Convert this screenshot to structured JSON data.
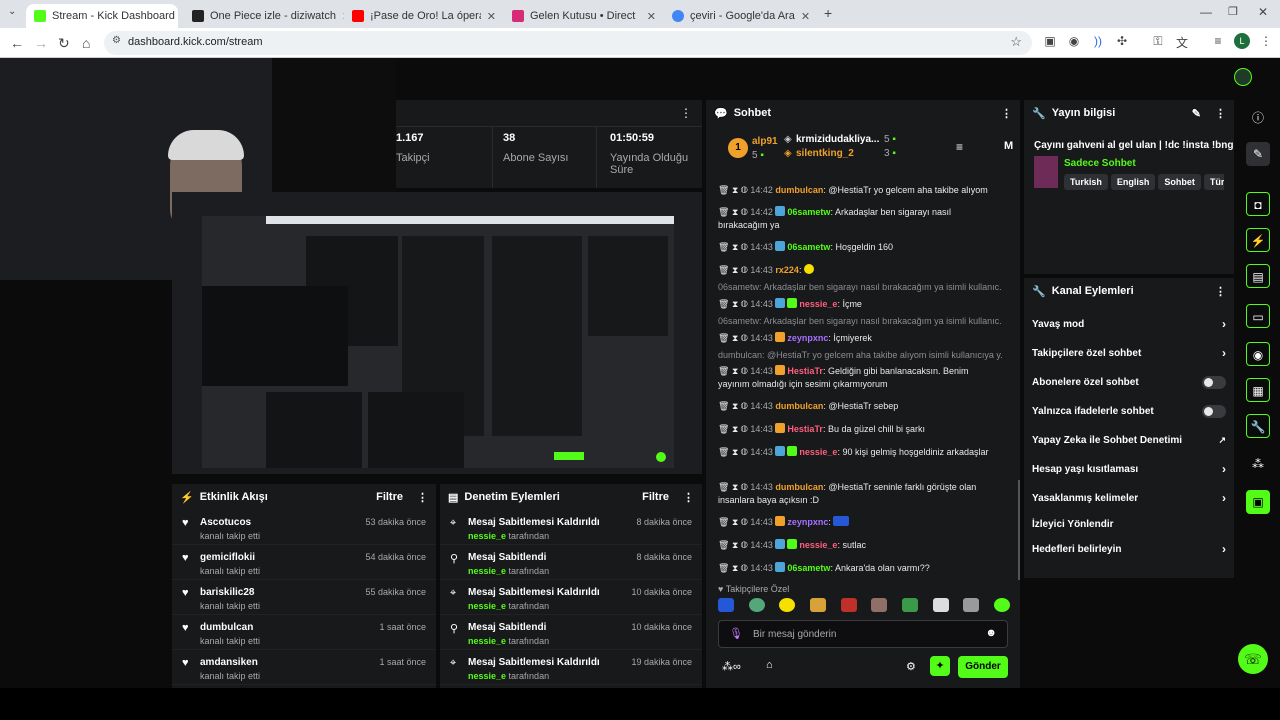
{
  "browser": {
    "tabs": [
      {
        "title": "Stream - Kick Dashboard",
        "color": "#53fc18"
      },
      {
        "title": "One Piece izle - diziwatch",
        "color": "#1d1d1d"
      },
      {
        "title": "¡Pase de Oro! La ópera y el roc",
        "color": "#ff0000"
      },
      {
        "title": "Gelen Kutusu • Direct",
        "color": "#d62976"
      },
      {
        "title": "çeviri - Google'da Ara",
        "color": "#4285f4"
      }
    ],
    "url": "dashboard.kick.com/stream",
    "profile_initial": "L"
  },
  "stats": [
    {
      "value": "1.167",
      "label": "Takipçi"
    },
    {
      "value": "38",
      "label": "Abone Sayısı"
    },
    {
      "value": "01:50:59",
      "label": "Yayında Olduğu Süre"
    }
  ],
  "activity": {
    "title": "Etkinlik Akışı",
    "filter": "Filtre",
    "items": [
      {
        "name": "Ascotucos",
        "sub": "kanalı takip etti",
        "time": "53 dakika önce"
      },
      {
        "name": "gemiciflokii",
        "sub": "kanalı takip etti",
        "time": "54 dakika önce"
      },
      {
        "name": "bariskilic28",
        "sub": "kanalı takip etti",
        "time": "55 dakika önce"
      },
      {
        "name": "dumbulcan",
        "sub": "kanalı takip etti",
        "time": "1 saat önce"
      },
      {
        "name": "amdansiken",
        "sub": "kanalı takip etti",
        "time": "1 saat önce"
      }
    ]
  },
  "mod": {
    "title": "Denetim Eylemleri",
    "filter": "Filtre",
    "items": [
      {
        "name": "Mesaj Sabitlemesi Kaldırıldı",
        "user": "nessie_e",
        "by": "tarafından",
        "time": "8 dakika önce"
      },
      {
        "name": "Mesaj Sabitlendi",
        "user": "nessie_e",
        "by": "tarafından",
        "time": "8 dakika önce"
      },
      {
        "name": "Mesaj Sabitlemesi Kaldırıldı",
        "user": "nessie_e",
        "by": "tarafından",
        "time": "10 dakika önce"
      },
      {
        "name": "Mesaj Sabitlendi",
        "user": "nessie_e",
        "by": "tarafından",
        "time": "10 dakika önce"
      },
      {
        "name": "Mesaj Sabitlemesi Kaldırıldı",
        "user": "nessie_e",
        "by": "tarafından",
        "time": "19 dakika önce"
      }
    ]
  },
  "chat": {
    "title": "Sohbet",
    "leaders": [
      {
        "rank": "1",
        "name": "alp91",
        "count": "5"
      },
      {
        "name": "krmizidudakliya...",
        "count": "5"
      },
      {
        "name": "silentking_2",
        "count": "3"
      }
    ],
    "messages": [
      {
        "time": "14:42",
        "user": "dumbulcan",
        "color": "#f0a12b",
        "text": ": @HestiaTr yo gelcem aha takibe alıyom"
      },
      {
        "time": "14:42",
        "user": "06sametw",
        "color": "#53fc18",
        "text": ": Arkadaşlar ben sigarayı nasıl bırakacağım ya"
      },
      {
        "time": "14:43",
        "user": "06sametw",
        "color": "#53fc18",
        "text": ": Hoşgeldin 160"
      },
      {
        "time": "14:43",
        "user": "rx224",
        "color": "#f0a12b",
        "text": ":"
      },
      {
        "time": "14:43",
        "user": "nessie_e",
        "color": "#ff5e7e",
        "text": ": İçme"
      },
      {
        "time": "14:43",
        "user": "zeynpxnc",
        "color": "#a970ff",
        "text": ": İçmiyerek"
      },
      {
        "time": "14:43",
        "user": "HestiaTr",
        "color": "#ff5e7e",
        "text": ": Geldiğin gibi banlanacaksın. Benim yayınım olmadığı için sesimi çıkarmıyorum"
      },
      {
        "time": "14:43",
        "user": "dumbulcan",
        "color": "#f0a12b",
        "text": ": @HestiaTr sebep"
      },
      {
        "time": "14:43",
        "user": "HestiaTr",
        "color": "#ff5e7e",
        "text": ": Bu da güzel chill bi şarkı"
      },
      {
        "time": "14:43",
        "user": "nessie_e",
        "color": "#ff5e7e",
        "text": ": 90 kişi gelmiş hoşgeldiniz arkadaşlar"
      },
      {
        "time": "14:43",
        "user": "dumbulcan",
        "color": "#f0a12b",
        "text": ": @HestiaTr seninle farklı görüşte olan insanlara baya açıksın :D"
      },
      {
        "time": "14:43",
        "user": "zeynpxnc",
        "color": "#a970ff",
        "text": ":"
      },
      {
        "time": "14:43",
        "user": "nessie_e",
        "color": "#ff5e7e",
        "text": ": sutlac"
      },
      {
        "time": "14:43",
        "user": "06sametw",
        "color": "#53fc18",
        "text": ": Ankara'da olan varmı??"
      }
    ],
    "replies": [
      "06sametw: Arkadaşlar ben sigarayı nasıl bırakacağım ya isimli kullanıc...",
      "06sametw: Arkadaşlar ben sigarayı nasıl bırakacağım ya isimli kullanıc...",
      "dumbulcan: @HestiaTr yo gelcem aha takibe alıyom isimli kullanıcıya y..."
    ],
    "emote_section": "Takipçilere Özel",
    "input_placeholder": "Bir mesaj gönderin",
    "send": "Gönder"
  },
  "stream_info": {
    "title": "Yayın bilgisi",
    "stream_title": "Çayını gahveni al gel ulan | !dc !insta !bng",
    "category": "Sadece Sohbet",
    "tags": [
      "Turkish",
      "English",
      "Sohbet",
      "Türkçe"
    ]
  },
  "channel_actions": {
    "title": "Kanal Eylemleri",
    "items": [
      {
        "label": "Yavaş mod",
        "kind": "arrow"
      },
      {
        "label": "Takipçilere özel sohbet",
        "kind": "arrow"
      },
      {
        "label": "Abonelere özel sohbet",
        "kind": "toggle"
      },
      {
        "label": "Yalnızca ifadelerle sohbet",
        "kind": "toggle"
      },
      {
        "label": "Yapay Zeka ile Sohbet Denetimi",
        "kind": "external"
      },
      {
        "label": "Hesap yaşı kısıtlaması",
        "kind": "arrow"
      },
      {
        "label": "Yasaklanmış kelimeler",
        "kind": "arrow"
      },
      {
        "label": "İzleyici Yönlendir",
        "kind": "none"
      },
      {
        "label": "Hedefleri belirleyin",
        "kind": "arrow"
      }
    ]
  }
}
